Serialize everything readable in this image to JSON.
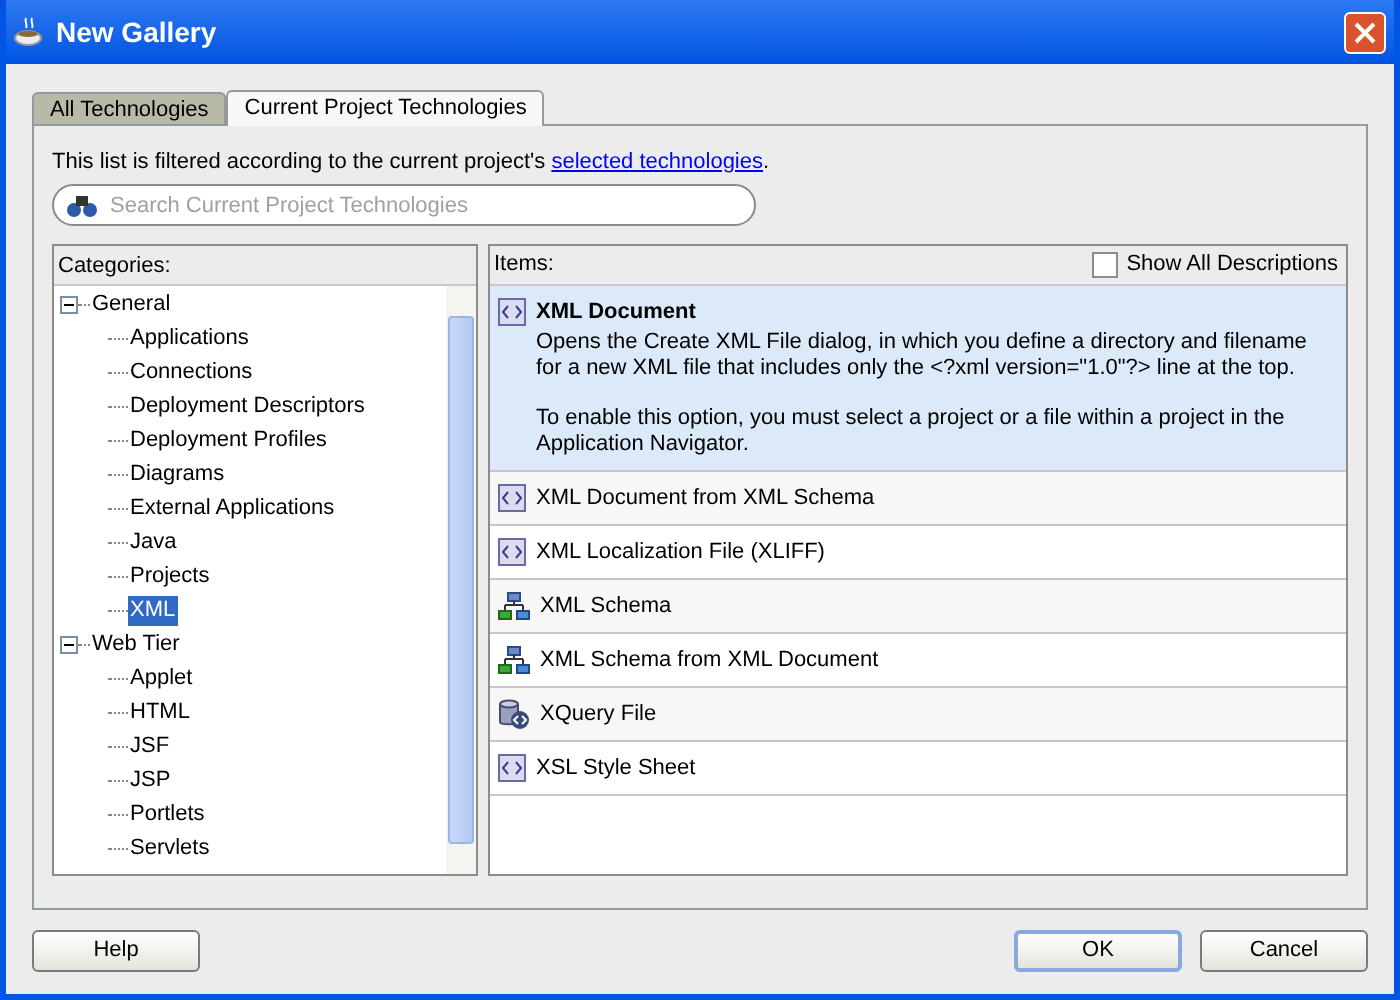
{
  "window": {
    "title": "New Gallery"
  },
  "tabs": [
    {
      "label": "All Technologies",
      "selected": false
    },
    {
      "label": "Current Project Technologies",
      "selected": true
    }
  ],
  "filter_note": {
    "text": "This list is filtered according to the current project's ",
    "link": "selected technologies",
    "suffix": "."
  },
  "search": {
    "placeholder": "Search Current Project Technologies"
  },
  "categories": {
    "label": "Categories:",
    "tree": [
      {
        "label": "General",
        "expanded": true,
        "selected": false,
        "children": [
          {
            "label": "Applications",
            "selected": false
          },
          {
            "label": "Connections",
            "selected": false
          },
          {
            "label": "Deployment Descriptors",
            "selected": false
          },
          {
            "label": "Deployment Profiles",
            "selected": false
          },
          {
            "label": "Diagrams",
            "selected": false
          },
          {
            "label": "External Applications",
            "selected": false
          },
          {
            "label": "Java",
            "selected": false
          },
          {
            "label": "Projects",
            "selected": false
          },
          {
            "label": "XML",
            "selected": true
          }
        ]
      },
      {
        "label": "Web Tier",
        "expanded": true,
        "selected": false,
        "children": [
          {
            "label": "Applet",
            "selected": false
          },
          {
            "label": "HTML",
            "selected": false
          },
          {
            "label": "JSF",
            "selected": false
          },
          {
            "label": "JSP",
            "selected": false
          },
          {
            "label": "Portlets",
            "selected": false
          },
          {
            "label": "Servlets",
            "selected": false
          }
        ]
      }
    ]
  },
  "items": {
    "label": "Items:",
    "show_all_descriptions": {
      "label": "Show All Descriptions",
      "checked": false
    },
    "list": [
      {
        "kind": "document",
        "label": "XML Document",
        "selected": true,
        "description": [
          "Opens the Create XML File dialog, in which you define a directory and filename for a new XML file that includes only the <?xml version=\"1.0\"?> line at the top.",
          "To enable this option, you must select a project or a file within a project in the Application Navigator."
        ]
      },
      {
        "kind": "document",
        "label": "XML Document from XML Schema",
        "selected": false
      },
      {
        "kind": "document",
        "label": "XML Localization File (XLIFF)",
        "selected": false
      },
      {
        "kind": "schema",
        "label": "XML Schema",
        "selected": false
      },
      {
        "kind": "schema",
        "label": "XML Schema from XML Document",
        "selected": false
      },
      {
        "kind": "query",
        "label": "XQuery File",
        "selected": false
      },
      {
        "kind": "document",
        "label": "XSL Style Sheet",
        "selected": false
      }
    ]
  },
  "buttons": [
    {
      "label": "Help",
      "default": false
    },
    {
      "label": "OK",
      "default": true
    },
    {
      "label": "Cancel",
      "default": false
    }
  ]
}
